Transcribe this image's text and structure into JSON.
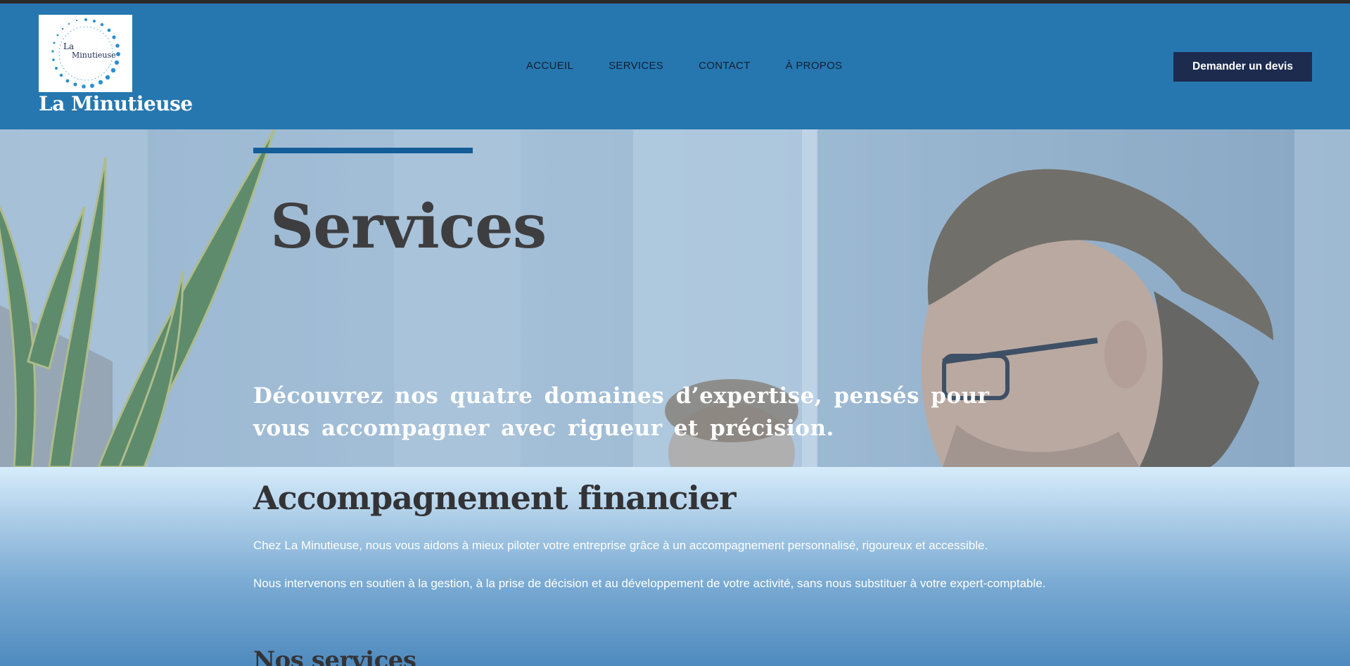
{
  "brand": {
    "logo_text_small": "La",
    "logo_text_main": "Minutieuse",
    "name": "La Minutieuse"
  },
  "nav": {
    "items": [
      {
        "label": "ACCUEIL"
      },
      {
        "label": "SERVICES"
      },
      {
        "label": "CONTACT"
      },
      {
        "label": "À PROPOS"
      }
    ]
  },
  "header": {
    "cta_label": "Demander un devis"
  },
  "hero": {
    "title": "Services",
    "subtitle": " Découvrez nos quatre domaines d’expertise, pensés pour vous accompagner avec rigueur et précision."
  },
  "content": {
    "heading": "Accompagnement financier",
    "paragraph_1": "Chez La Minutieuse, nous vous aidons à mieux piloter votre entreprise grâce à un accompagnement personnalisé, rigoureux et accessible.",
    "paragraph_2": "Nous intervenons en soutien à la gestion, à la prise de décision et au développement de votre activité, sans nous substituer à votre expert-comptable.",
    "subheading": "Nos services"
  },
  "colors": {
    "header_bg": "#2677af",
    "cta_bg": "#1d2b4f",
    "accent_bar": "#135d98",
    "heading_text": "#333336"
  }
}
